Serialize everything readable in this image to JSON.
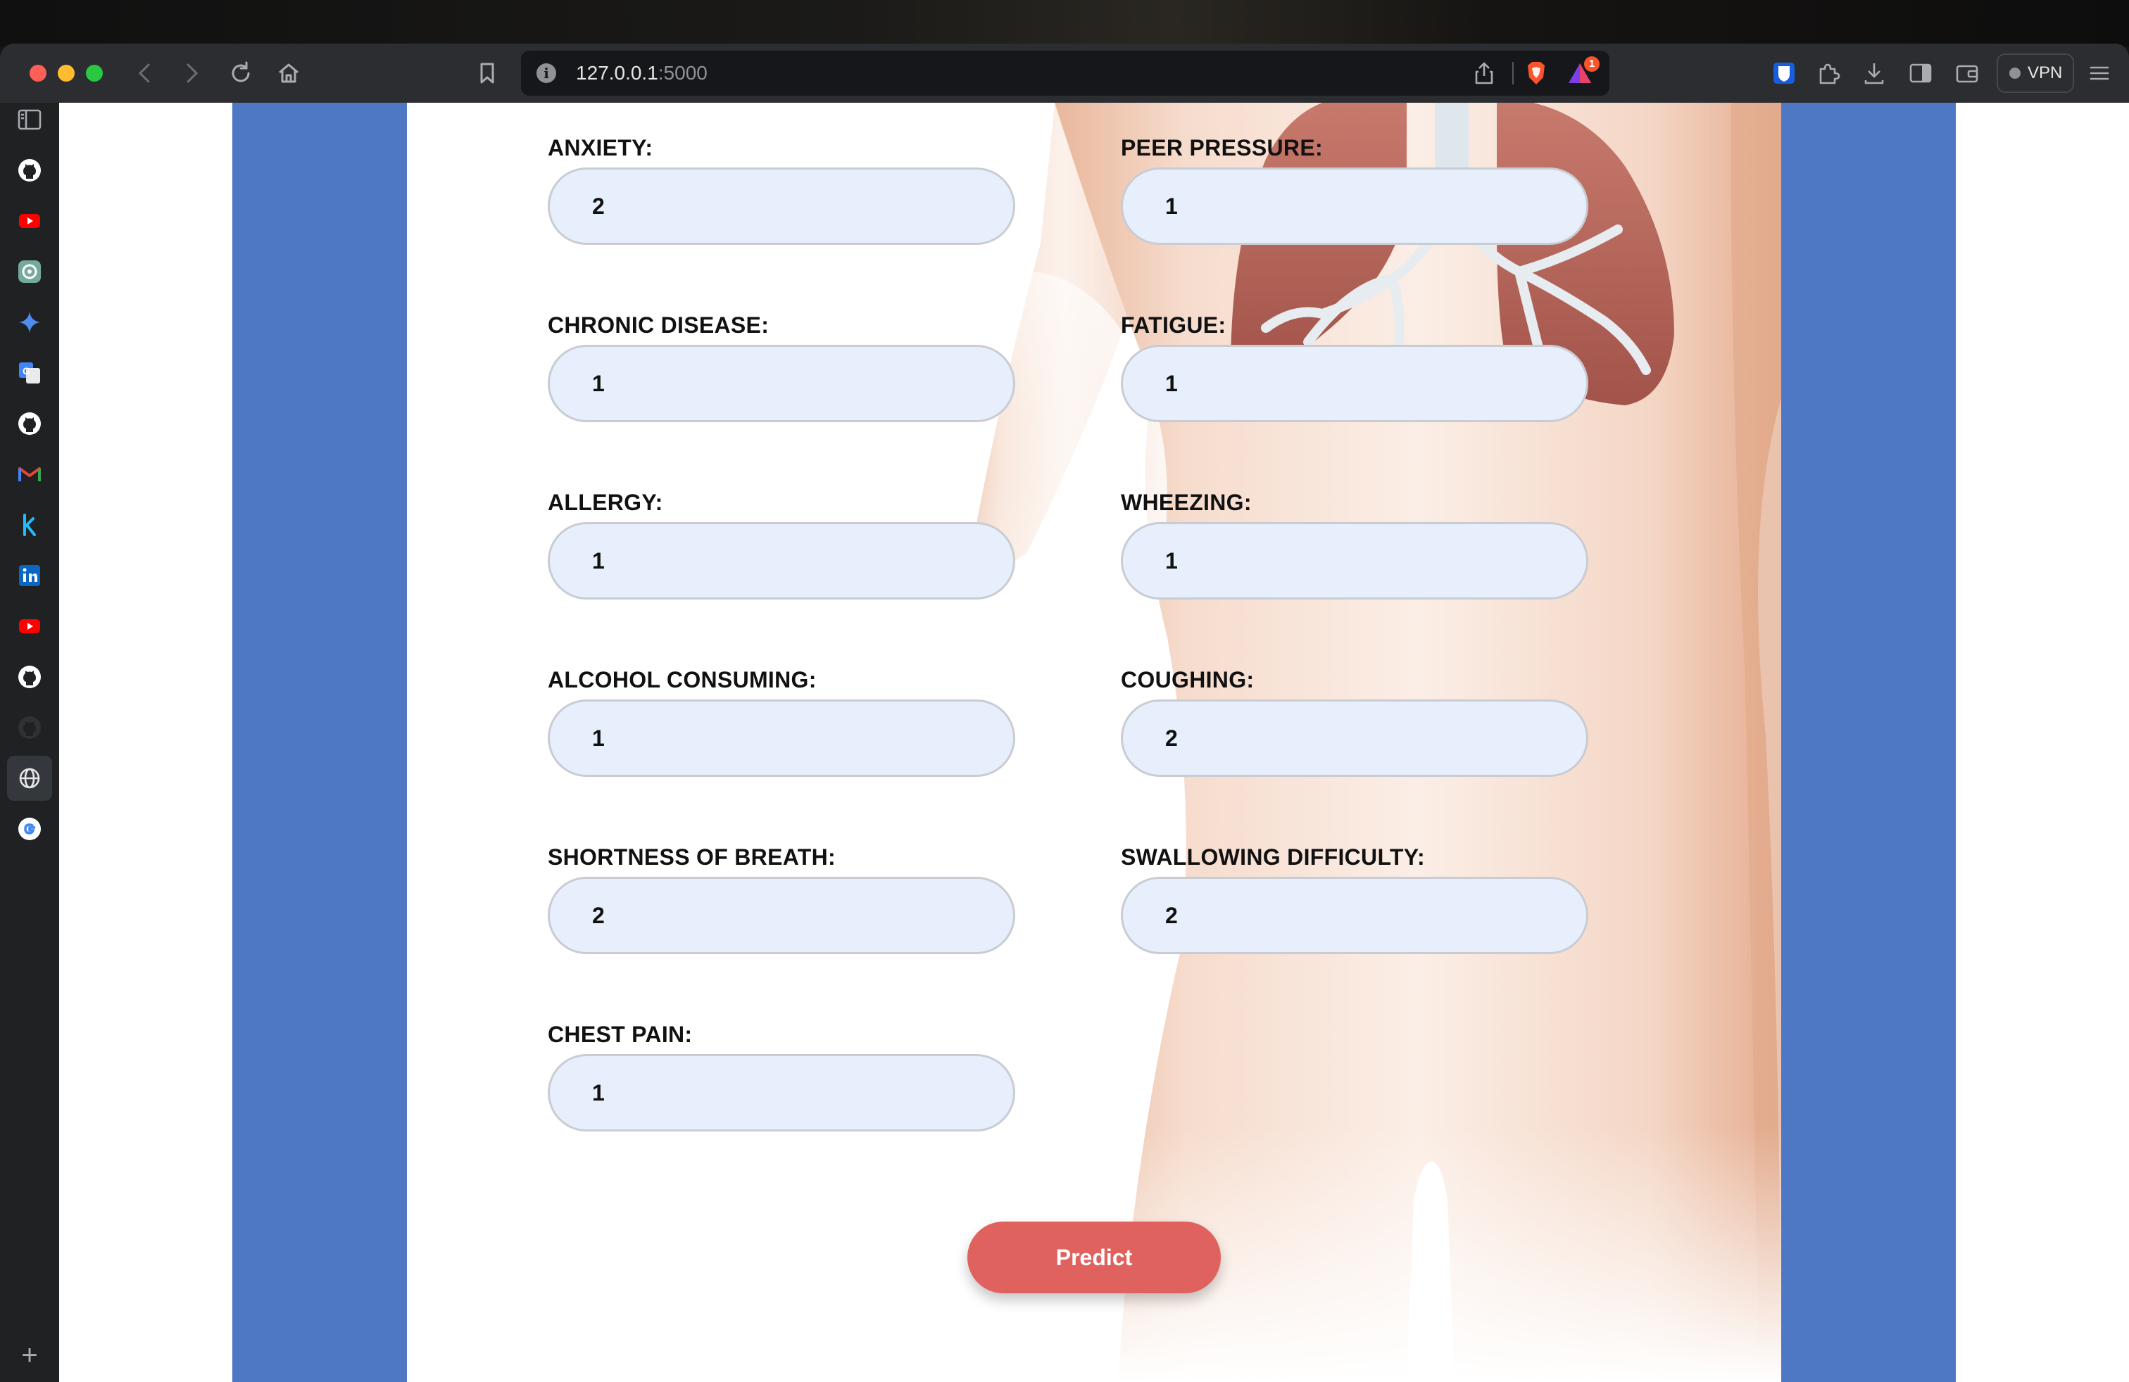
{
  "browser": {
    "url_host": "127.0.0.1",
    "url_port": ":5000",
    "rewards_badge": "1",
    "vpn_label": "VPN"
  },
  "sidebar": {
    "items": [
      {
        "name": "github-icon"
      },
      {
        "name": "youtube-icon"
      },
      {
        "name": "chatgpt-icon"
      },
      {
        "name": "gemini-icon"
      },
      {
        "name": "google-translate-icon"
      },
      {
        "name": "github-icon"
      },
      {
        "name": "gmail-icon"
      },
      {
        "name": "kaggle-icon"
      },
      {
        "name": "linkedin-icon"
      },
      {
        "name": "youtube-icon"
      },
      {
        "name": "github-icon"
      },
      {
        "name": "github-icon"
      },
      {
        "name": "globe-icon"
      },
      {
        "name": "google-icon"
      }
    ],
    "add_label": "+"
  },
  "form": {
    "fields": [
      {
        "label": "ANXIETY:",
        "value": "2"
      },
      {
        "label": "PEER PRESSURE:",
        "value": "1"
      },
      {
        "label": "CHRONIC DISEASE:",
        "value": "1"
      },
      {
        "label": "FATIGUE:",
        "value": "1"
      },
      {
        "label": "ALLERGY:",
        "value": "1"
      },
      {
        "label": "WHEEZING:",
        "value": "1"
      },
      {
        "label": "ALCOHOL CONSUMING:",
        "value": "1"
      },
      {
        "label": "COUGHING:",
        "value": "2"
      },
      {
        "label": "SHORTNESS OF BREATH:",
        "value": "2"
      },
      {
        "label": "SWALLOWING DIFFICULTY:",
        "value": "2"
      },
      {
        "label": "CHEST PAIN:",
        "value": "1"
      }
    ],
    "submit_label": "Predict"
  },
  "colors": {
    "side_band": "#4e78c4",
    "input_bg": "#e8effc",
    "button": "#e0625f"
  }
}
